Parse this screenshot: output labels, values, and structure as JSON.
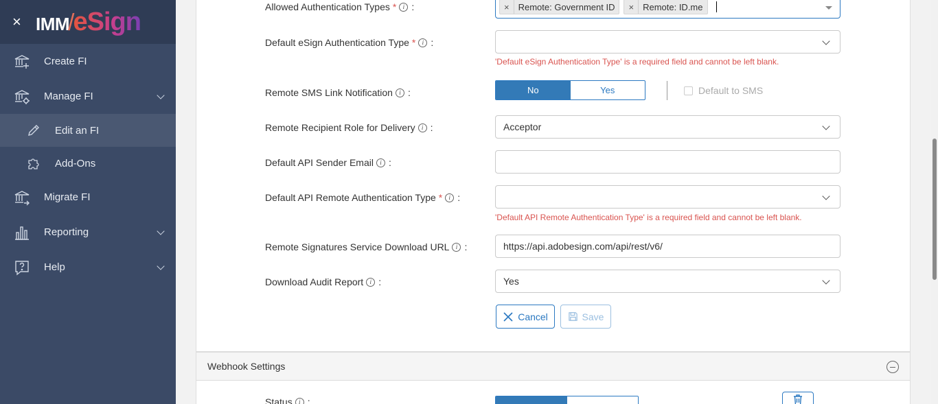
{
  "sidebar": {
    "close_glyph": "×",
    "logo_left": "IMM",
    "logo_slash": "/",
    "logo_right": "eSign",
    "items": [
      {
        "label": "Create FI",
        "icon": "bank-plus-icon"
      },
      {
        "label": "Manage FI",
        "icon": "bank-gear-icon"
      },
      {
        "label": "Edit an FI",
        "icon": "pencil-icon"
      },
      {
        "label": "Add-Ons",
        "icon": "puzzle-icon"
      },
      {
        "label": "Migrate FI",
        "icon": "bank-arrow-icon"
      },
      {
        "label": "Reporting",
        "icon": "bar-chart-icon"
      },
      {
        "label": "Help",
        "icon": "question-bubble-icon"
      }
    ]
  },
  "form": {
    "allowed_auth": {
      "label": "Allowed Authentication Types",
      "tags": [
        "Remote: Government ID",
        "Remote: ID.me"
      ]
    },
    "default_esign_auth": {
      "label": "Default eSign Authentication Type",
      "value": "",
      "error": "'Default eSign Authentication Type' is a required field and cannot be left blank."
    },
    "remote_sms": {
      "label": "Remote SMS Link Notification",
      "options": [
        "No",
        "Yes"
      ],
      "selected": "No",
      "default_sms_label": "Default to SMS"
    },
    "recipient_role": {
      "label": "Remote Recipient Role for Delivery",
      "value": "Acceptor"
    },
    "api_sender_email": {
      "label": "Default API Sender Email",
      "value": ""
    },
    "api_remote_auth": {
      "label": "Default API Remote Authentication Type",
      "value": "",
      "error": "'Default API Remote Authentication Type' is a required field and cannot be left blank."
    },
    "download_url": {
      "label": "Remote Signatures Service Download URL",
      "value": "https://api.adobesign.com/api/rest/v6/"
    },
    "audit_report": {
      "label": "Download Audit Report",
      "value": "Yes"
    },
    "cancel_label": "Cancel",
    "save_label": "Save"
  },
  "webhook": {
    "title": "Webhook Settings",
    "status_label": "Status"
  },
  "common": {
    "req": "*",
    "info": "i",
    "colon": ":",
    "remove": "×"
  },
  "colors": {
    "sidebar_bg": "#3b4a66",
    "accent": "#2a78c1",
    "error": "#d9534f"
  }
}
